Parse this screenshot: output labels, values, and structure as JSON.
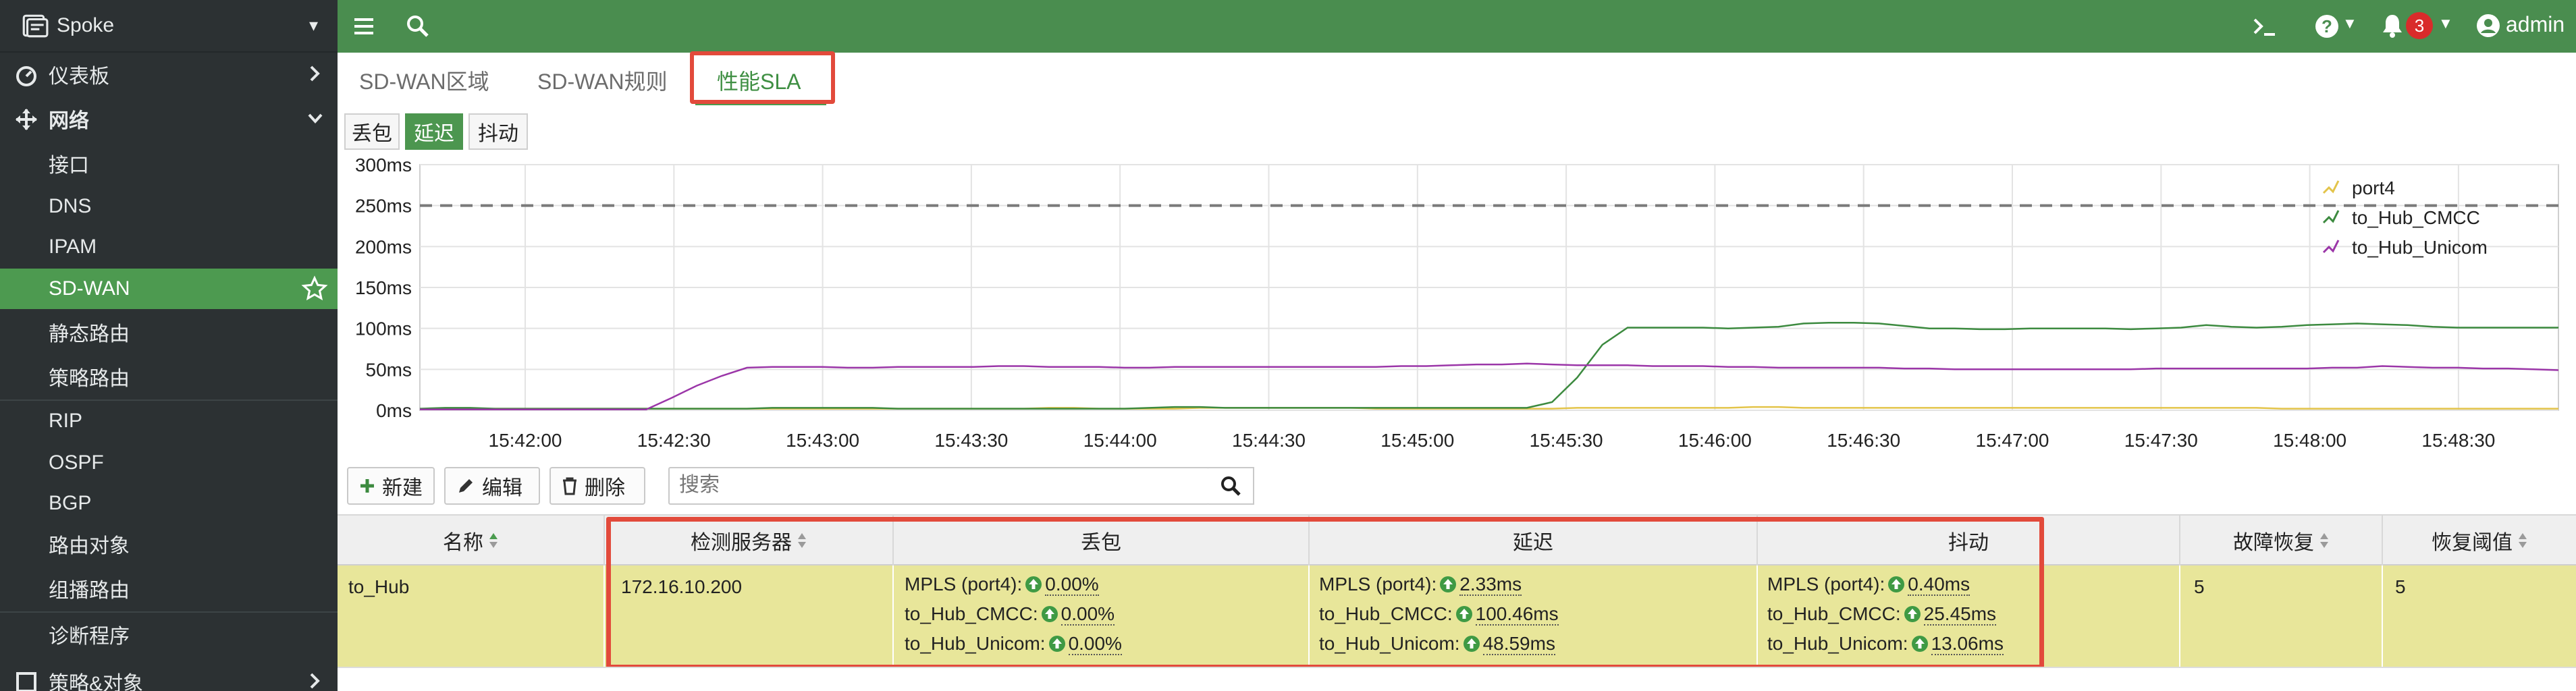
{
  "sidebar": {
    "device": "Spoke",
    "items": [
      {
        "label": "仪表板"
      },
      {
        "label": "网络"
      },
      {
        "label": "接口"
      },
      {
        "label": "DNS"
      },
      {
        "label": "IPAM"
      },
      {
        "label": "SD-WAN"
      },
      {
        "label": "静态路由"
      },
      {
        "label": "策略路由"
      },
      {
        "label": "RIP"
      },
      {
        "label": "OSPF"
      },
      {
        "label": "BGP"
      },
      {
        "label": "路由对象"
      },
      {
        "label": "组播路由"
      },
      {
        "label": "诊断程序"
      },
      {
        "label": "策略&对象"
      }
    ]
  },
  "topbar": {
    "user": "admin",
    "notifications": "3",
    "colors": {
      "bar": "#4a8d4f",
      "badge": "#d92b2b"
    }
  },
  "tabs": [
    {
      "label": "SD-WAN区域"
    },
    {
      "label": "SD-WAN规则"
    },
    {
      "label": "性能SLA"
    }
  ],
  "metric_toggle": [
    "丢包",
    "延迟",
    "抖动"
  ],
  "chart_data": {
    "type": "line",
    "y_ticks": [
      "300ms",
      "250ms",
      "200ms",
      "150ms",
      "100ms",
      "50ms",
      "0ms"
    ],
    "ylim": [
      0,
      300
    ],
    "threshold": 250,
    "x_ticks": [
      "15:42:00",
      "15:42:30",
      "15:43:00",
      "15:43:30",
      "15:44:00",
      "15:44:30",
      "15:45:00",
      "15:45:30",
      "15:46:00",
      "15:46:30",
      "15:47:00",
      "15:47:30",
      "15:48:00",
      "15:48:30"
    ],
    "grid": true,
    "legend_position": "top-right",
    "series": [
      {
        "name": "port4",
        "color": "#e3c44a",
        "points": [
          [
            0,
            1
          ],
          [
            1,
            1
          ],
          [
            2,
            1
          ],
          [
            3,
            2
          ],
          [
            4,
            2
          ],
          [
            5,
            2
          ],
          [
            6,
            2
          ],
          [
            7,
            2
          ],
          [
            8,
            2
          ],
          [
            9,
            2
          ],
          [
            10,
            2
          ],
          [
            11,
            2
          ],
          [
            12,
            2
          ],
          [
            13,
            2
          ],
          [
            14,
            2
          ],
          [
            15,
            2
          ],
          [
            16,
            2
          ],
          [
            17,
            2
          ],
          [
            18,
            2
          ],
          [
            19,
            2
          ],
          [
            20,
            2
          ],
          [
            21,
            2
          ],
          [
            22,
            2
          ],
          [
            23,
            2
          ],
          [
            24,
            2
          ],
          [
            25,
            3
          ],
          [
            26,
            3
          ],
          [
            27,
            2
          ],
          [
            28,
            2
          ],
          [
            29,
            2
          ],
          [
            30,
            2
          ],
          [
            31,
            3
          ],
          [
            32,
            3
          ],
          [
            33,
            3
          ],
          [
            34,
            3
          ],
          [
            35,
            3
          ],
          [
            36,
            3
          ],
          [
            37,
            3
          ],
          [
            38,
            2
          ],
          [
            39,
            2
          ],
          [
            40,
            2
          ],
          [
            41,
            2
          ],
          [
            42,
            2
          ],
          [
            43,
            2
          ],
          [
            44,
            2
          ],
          [
            45,
            2
          ],
          [
            46,
            3
          ],
          [
            47,
            3
          ],
          [
            48,
            3
          ],
          [
            49,
            3
          ],
          [
            50,
            3
          ],
          [
            51,
            3
          ],
          [
            52,
            3
          ],
          [
            53,
            4
          ],
          [
            54,
            4
          ],
          [
            55,
            3
          ],
          [
            56,
            3
          ],
          [
            57,
            3
          ],
          [
            58,
            3
          ],
          [
            59,
            3
          ],
          [
            60,
            3
          ],
          [
            61,
            3
          ],
          [
            62,
            3
          ],
          [
            63,
            3
          ],
          [
            64,
            3
          ],
          [
            65,
            3
          ],
          [
            66,
            3
          ],
          [
            67,
            3
          ],
          [
            68,
            3
          ],
          [
            69,
            3
          ],
          [
            70,
            3
          ],
          [
            71,
            3
          ],
          [
            72,
            3
          ],
          [
            73,
            3
          ],
          [
            74,
            2
          ],
          [
            75,
            2
          ],
          [
            76,
            2
          ],
          [
            77,
            2
          ],
          [
            78,
            2
          ],
          [
            79,
            2
          ],
          [
            80,
            2
          ],
          [
            81,
            2
          ],
          [
            82,
            2
          ],
          [
            83,
            2
          ],
          [
            84,
            2
          ],
          [
            85,
            2
          ]
        ]
      },
      {
        "name": "to_Hub_CMCC",
        "color": "#3c8a3f",
        "points": [
          [
            0,
            2
          ],
          [
            1,
            3
          ],
          [
            2,
            3
          ],
          [
            3,
            2
          ],
          [
            4,
            2
          ],
          [
            5,
            2
          ],
          [
            6,
            2
          ],
          [
            7,
            2
          ],
          [
            8,
            2
          ],
          [
            9,
            2
          ],
          [
            10,
            2
          ],
          [
            11,
            2
          ],
          [
            12,
            2
          ],
          [
            13,
            2
          ],
          [
            14,
            3
          ],
          [
            15,
            3
          ],
          [
            16,
            3
          ],
          [
            17,
            3
          ],
          [
            18,
            3
          ],
          [
            19,
            2
          ],
          [
            20,
            2
          ],
          [
            21,
            2
          ],
          [
            22,
            2
          ],
          [
            23,
            2
          ],
          [
            24,
            2
          ],
          [
            25,
            2
          ],
          [
            26,
            2
          ],
          [
            27,
            2
          ],
          [
            28,
            2
          ],
          [
            29,
            3
          ],
          [
            30,
            4
          ],
          [
            31,
            4
          ],
          [
            32,
            3
          ],
          [
            33,
            3
          ],
          [
            34,
            3
          ],
          [
            35,
            3
          ],
          [
            36,
            3
          ],
          [
            37,
            3
          ],
          [
            38,
            3
          ],
          [
            39,
            3
          ],
          [
            40,
            3
          ],
          [
            41,
            3
          ],
          [
            42,
            3
          ],
          [
            43,
            3
          ],
          [
            44,
            3
          ],
          [
            45,
            10
          ],
          [
            46,
            40
          ],
          [
            47,
            80
          ],
          [
            48,
            101
          ],
          [
            49,
            101
          ],
          [
            50,
            101
          ],
          [
            51,
            101
          ],
          [
            52,
            100
          ],
          [
            53,
            101
          ],
          [
            54,
            102
          ],
          [
            55,
            106
          ],
          [
            56,
            107
          ],
          [
            57,
            107
          ],
          [
            58,
            106
          ],
          [
            59,
            103
          ],
          [
            60,
            100
          ],
          [
            61,
            100
          ],
          [
            62,
            99
          ],
          [
            63,
            99
          ],
          [
            64,
            100
          ],
          [
            65,
            100
          ],
          [
            66,
            100
          ],
          [
            67,
            100
          ],
          [
            68,
            99
          ],
          [
            69,
            100
          ],
          [
            70,
            101
          ],
          [
            71,
            104
          ],
          [
            72,
            102
          ],
          [
            73,
            101
          ],
          [
            74,
            102
          ],
          [
            75,
            104
          ],
          [
            76,
            105
          ],
          [
            77,
            106
          ],
          [
            78,
            105
          ],
          [
            79,
            104
          ],
          [
            80,
            102
          ],
          [
            81,
            101
          ],
          [
            82,
            101
          ],
          [
            83,
            101
          ],
          [
            84,
            101
          ],
          [
            85,
            101
          ]
        ]
      },
      {
        "name": "to_Hub_Unicom",
        "color": "#9b36a8",
        "points": [
          [
            0,
            1
          ],
          [
            1,
            1
          ],
          [
            2,
            1
          ],
          [
            3,
            1
          ],
          [
            4,
            1
          ],
          [
            5,
            1
          ],
          [
            6,
            1
          ],
          [
            7,
            1
          ],
          [
            8,
            1
          ],
          [
            9,
            1
          ],
          [
            10,
            15
          ],
          [
            11,
            30
          ],
          [
            12,
            42
          ],
          [
            13,
            52
          ],
          [
            14,
            53
          ],
          [
            15,
            53
          ],
          [
            16,
            53
          ],
          [
            17,
            52
          ],
          [
            18,
            52
          ],
          [
            19,
            53
          ],
          [
            20,
            53
          ],
          [
            21,
            53
          ],
          [
            22,
            53
          ],
          [
            23,
            54
          ],
          [
            24,
            54
          ],
          [
            25,
            53
          ],
          [
            26,
            53
          ],
          [
            27,
            53
          ],
          [
            28,
            52
          ],
          [
            29,
            52
          ],
          [
            30,
            53
          ],
          [
            31,
            53
          ],
          [
            32,
            53
          ],
          [
            33,
            53
          ],
          [
            34,
            53
          ],
          [
            35,
            53
          ],
          [
            36,
            53
          ],
          [
            37,
            53
          ],
          [
            38,
            53
          ],
          [
            39,
            54
          ],
          [
            40,
            54
          ],
          [
            41,
            55
          ],
          [
            42,
            56
          ],
          [
            43,
            56
          ],
          [
            44,
            57
          ],
          [
            45,
            56
          ],
          [
            46,
            55
          ],
          [
            47,
            55
          ],
          [
            48,
            55
          ],
          [
            49,
            54
          ],
          [
            50,
            54
          ],
          [
            51,
            54
          ],
          [
            52,
            53
          ],
          [
            53,
            53
          ],
          [
            54,
            52
          ],
          [
            55,
            52
          ],
          [
            56,
            52
          ],
          [
            57,
            52
          ],
          [
            58,
            52
          ],
          [
            59,
            51
          ],
          [
            60,
            51
          ],
          [
            61,
            50
          ],
          [
            62,
            50
          ],
          [
            63,
            50
          ],
          [
            64,
            50
          ],
          [
            65,
            50
          ],
          [
            66,
            50
          ],
          [
            67,
            50
          ],
          [
            68,
            50
          ],
          [
            69,
            51
          ],
          [
            70,
            51
          ],
          [
            71,
            51
          ],
          [
            72,
            51
          ],
          [
            73,
            51
          ],
          [
            74,
            51
          ],
          [
            75,
            51
          ],
          [
            76,
            52
          ],
          [
            77,
            52
          ],
          [
            78,
            54
          ],
          [
            79,
            53
          ],
          [
            80,
            52
          ],
          [
            81,
            52
          ],
          [
            82,
            51
          ],
          [
            83,
            51
          ],
          [
            84,
            50
          ],
          [
            85,
            49
          ]
        ]
      }
    ]
  },
  "toolbar": {
    "new_label": "新建",
    "edit_label": "编辑",
    "delete_label": "删除",
    "search_placeholder": "搜索"
  },
  "table": {
    "headers": [
      "名称",
      "检测服务器",
      "丢包",
      "延迟",
      "抖动",
      "故障恢复",
      "恢复阈值"
    ],
    "row": {
      "name": "to_Hub",
      "server": "172.16.10.200",
      "loss": [
        {
          "label": "MPLS (port4):",
          "value": "0.00%"
        },
        {
          "label": "to_Hub_CMCC:",
          "value": "0.00%"
        },
        {
          "label": "to_Hub_Unicom:",
          "value": "0.00%"
        }
      ],
      "latency": [
        {
          "label": "MPLS (port4):",
          "value": "2.33ms"
        },
        {
          "label": "to_Hub_CMCC:",
          "value": "100.46ms"
        },
        {
          "label": "to_Hub_Unicom:",
          "value": "48.59ms"
        }
      ],
      "jitter": [
        {
          "label": "MPLS (port4):",
          "value": "0.40ms"
        },
        {
          "label": "to_Hub_CMCC:",
          "value": "25.45ms"
        },
        {
          "label": "to_Hub_Unicom:",
          "value": "13.06ms"
        }
      ],
      "failover": "5",
      "restore": "5"
    }
  }
}
